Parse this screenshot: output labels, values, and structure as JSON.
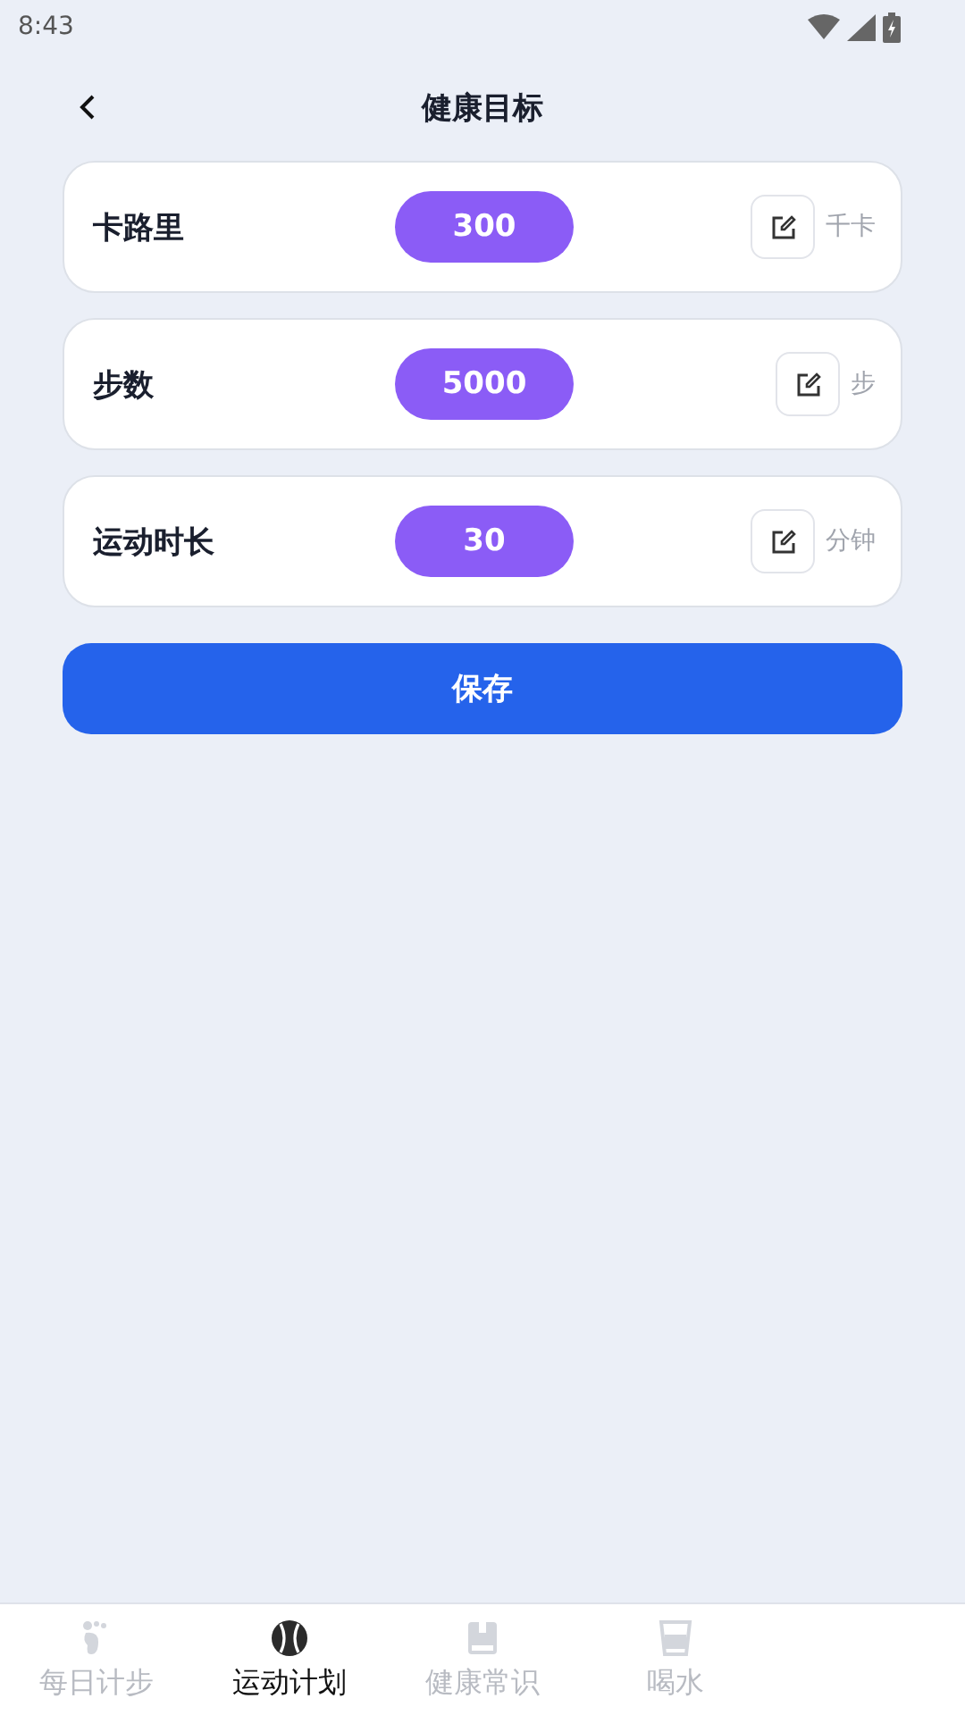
{
  "status_bar": {
    "time": "8:43"
  },
  "header": {
    "title": "健康目标"
  },
  "goals": [
    {
      "label": "卡路里",
      "value": "300",
      "unit": "千卡"
    },
    {
      "label": "步数",
      "value": "5000",
      "unit": "步"
    },
    {
      "label": "运动时长",
      "value": "30",
      "unit": "分钟"
    }
  ],
  "save_button": "保存",
  "tabs": [
    {
      "label": "每日计步",
      "kind": "foot",
      "selected": false
    },
    {
      "label": "运动计划",
      "kind": "ball",
      "selected": true
    },
    {
      "label": "健康常识",
      "kind": "book",
      "selected": false
    },
    {
      "label": "喝水",
      "kind": "cup",
      "selected": false
    }
  ]
}
